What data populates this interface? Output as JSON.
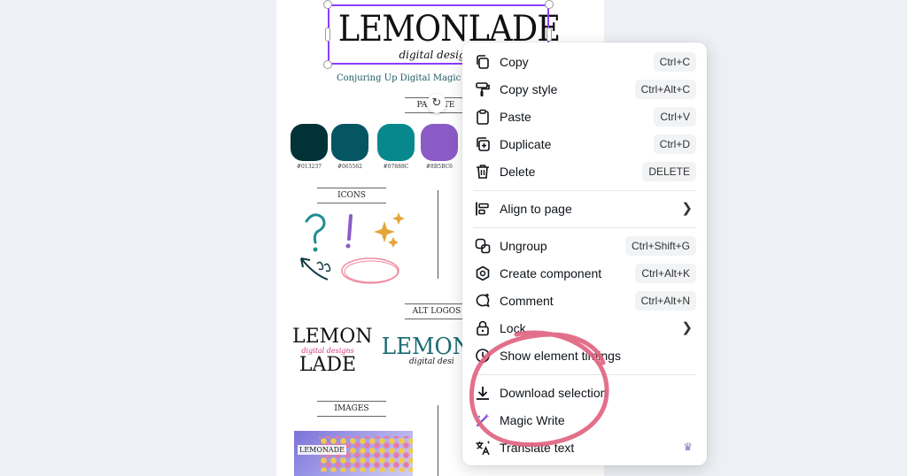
{
  "canvas": {
    "logo_text": "LEMONLADE",
    "logo_script": "digital designs",
    "tagline": "Conjuring Up Digital Magic",
    "palette_label": "PALETTE",
    "swatches": [
      {
        "color": "#013237",
        "code": "#013237"
      },
      {
        "color": "#065562",
        "code": "#065562"
      },
      {
        "color": "#07888C",
        "code": "#07888C"
      },
      {
        "color": "#8B5BC6",
        "code": "#8B5BC6"
      }
    ],
    "icons_label": "ICONS",
    "alt_logos_label": "ALT LOGOS",
    "alt_logo1_top": "LEMON",
    "alt_logo1_script": "digital designs",
    "alt_logo1_bottom": "LADE",
    "alt_logo2": "LEMONL",
    "alt_logo2_script": "digital desi",
    "images_label": "IMAGES",
    "thumb_text": "LEMONADE"
  },
  "menu": {
    "items": [
      {
        "label": "Copy",
        "shortcut": "Ctrl+C",
        "icon": "copy-icon"
      },
      {
        "label": "Copy style",
        "shortcut": "Ctrl+Alt+C",
        "icon": "paint-roller-icon"
      },
      {
        "label": "Paste",
        "shortcut": "Ctrl+V",
        "icon": "clipboard-icon"
      },
      {
        "label": "Duplicate",
        "shortcut": "Ctrl+D",
        "icon": "duplicate-icon"
      },
      {
        "label": "Delete",
        "shortcut": "DELETE",
        "icon": "trash-icon"
      },
      {
        "label": "Align to page",
        "icon": "align-icon",
        "submenu": true
      },
      {
        "label": "Ungroup",
        "shortcut": "Ctrl+Shift+G",
        "icon": "ungroup-icon"
      },
      {
        "label": "Create component",
        "shortcut": "Ctrl+Alt+K",
        "icon": "component-icon"
      },
      {
        "label": "Comment",
        "shortcut": "Ctrl+Alt+N",
        "icon": "comment-icon"
      },
      {
        "label": "Lock",
        "icon": "lock-icon",
        "submenu": true
      },
      {
        "label": "Show element timings",
        "icon": "clock-icon"
      },
      {
        "label": "Download selection",
        "icon": "download-icon"
      },
      {
        "label": "Magic Write",
        "icon": "magic-wand-icon"
      },
      {
        "label": "Translate text",
        "icon": "translate-icon",
        "premium": true
      }
    ]
  },
  "colors": {
    "selection": "#8b3dff",
    "annotation": "#e0607e"
  }
}
